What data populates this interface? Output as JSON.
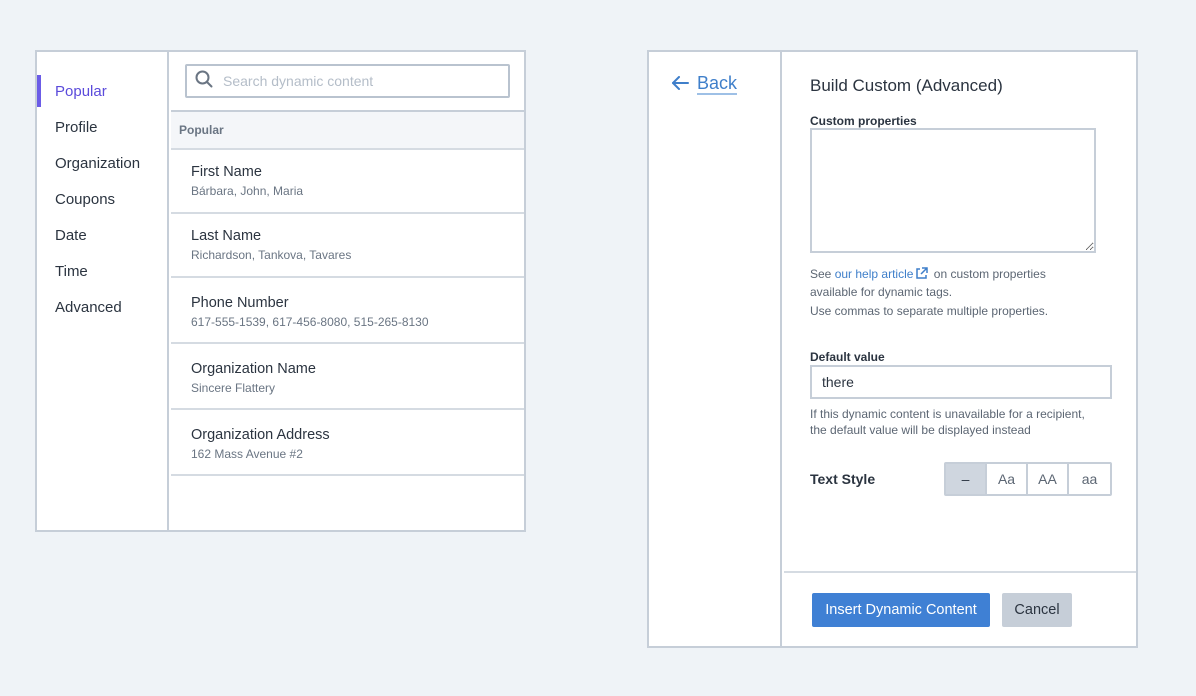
{
  "categories": {
    "items": [
      {
        "label": "Popular",
        "active": true
      },
      {
        "label": "Profile"
      },
      {
        "label": "Organization"
      },
      {
        "label": "Coupons"
      },
      {
        "label": "Date"
      },
      {
        "label": "Time"
      },
      {
        "label": "Advanced"
      }
    ]
  },
  "search": {
    "placeholder": "Search dynamic content",
    "icon": "search-icon"
  },
  "content": {
    "section_title": "Popular",
    "items": [
      {
        "name": "First Name",
        "examples": "Bárbara, John, Maria"
      },
      {
        "name": "Last Name",
        "examples": "Richardson, Tankova, Tavares"
      },
      {
        "name": "Phone Number",
        "examples": "617-555-1539, 617-456-8080, 515-265-8130"
      },
      {
        "name": "Organization Name",
        "examples": "Sincere Flattery"
      },
      {
        "name": "Organization Address",
        "examples": "162 Mass Avenue #2"
      }
    ]
  },
  "custom": {
    "back_label": "Back",
    "title": "Build Custom (Advanced)",
    "properties_label": "Custom properties",
    "properties_value": "",
    "help_prefix": "See",
    "help_link": "our help article",
    "help_suffix": "on custom properties",
    "help_line2": "available for dynamic tags.",
    "help_note": "Use commas to separate multiple properties.",
    "default_label": "Default value",
    "default_value": "there",
    "default_help_line1": "If this dynamic content is unavailable for a recipient,",
    "default_help_line2": "the default value will be displayed instead",
    "text_style_label": "Text Style",
    "text_style_options": [
      "–",
      "Aa",
      "AA",
      "aa"
    ],
    "text_style_selected": 0,
    "insert_button": "Insert Dynamic Content",
    "cancel_button": "Cancel"
  },
  "colors": {
    "accent": "#6b5ce7",
    "link": "#3f7fca",
    "primary": "#3f80d4"
  }
}
